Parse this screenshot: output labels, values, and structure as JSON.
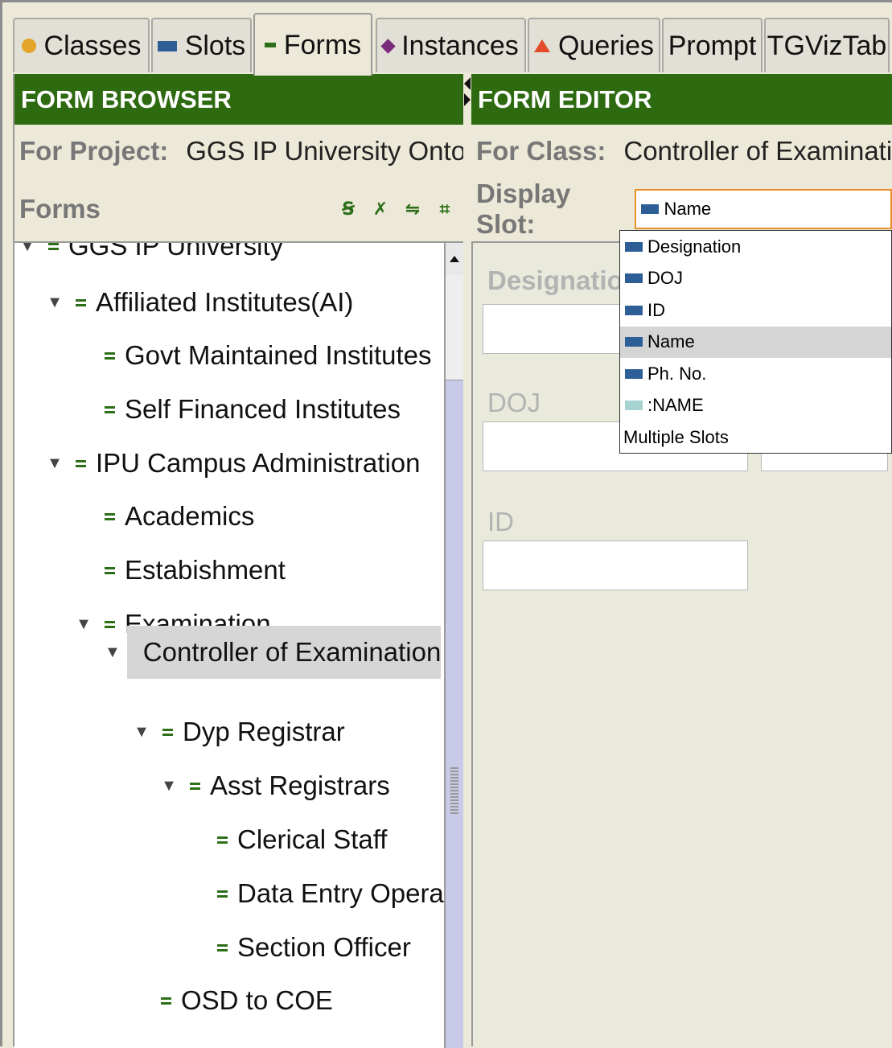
{
  "tabs": [
    {
      "label": "Classes",
      "icon": "class-dot-icon",
      "color": "#e5a52a"
    },
    {
      "label": "Slots",
      "icon": "slot-bar-icon",
      "color": "#2d5f96"
    },
    {
      "label": "Forms",
      "icon": "forms-icon",
      "color": "#2d6f18",
      "active": true
    },
    {
      "label": "Instances",
      "icon": "instance-diamond-icon",
      "color": "#7a2b7a"
    },
    {
      "label": "Queries",
      "icon": "query-triangle-icon",
      "color": "#e34a2a"
    },
    {
      "label": "Prompt"
    },
    {
      "label": "TGVizTab"
    }
  ],
  "form_browser": {
    "title": "FORM BROWSER",
    "project_label": "For Project:",
    "project_name": "GGS IP University Ontology",
    "forms_label": "Forms",
    "tree": [
      {
        "label": "GGS IP University",
        "expanded": true
      },
      {
        "label": "Affiliated Institutes(AI)",
        "expanded": true
      },
      {
        "label": "Govt Maintained Institutes"
      },
      {
        "label": "Self Financed Institutes"
      },
      {
        "label": "IPU Campus Administration",
        "expanded": true
      },
      {
        "label": "Academics"
      },
      {
        "label": "Estabishment"
      },
      {
        "label": "Examination",
        "expanded": true
      },
      {
        "label": "Controller of Examination",
        "expanded": true,
        "selected": true
      },
      {
        "label": "Dyp Registrar",
        "expanded": true
      },
      {
        "label": "Asst Registrars",
        "expanded": true
      },
      {
        "label": "Clerical Staff"
      },
      {
        "label": "Data Entry Operator"
      },
      {
        "label": "Section Officer"
      },
      {
        "label": "OSD to COE"
      }
    ]
  },
  "form_editor": {
    "title": "FORM EDITOR",
    "class_label": "For Class:",
    "class_name": "Controller of Examination",
    "display_slot_label": "Display Slot:",
    "display_slot_value": "Name",
    "fields": {
      "designation": "Designation",
      "doj": "DOJ",
      "id": "ID"
    },
    "dropdown_options": [
      {
        "label": "Designation",
        "icon": "slot"
      },
      {
        "label": "DOJ",
        "icon": "slot"
      },
      {
        "label": "ID",
        "icon": "slot"
      },
      {
        "label": "Name",
        "icon": "slot",
        "highlighted": true
      },
      {
        "label": "Ph. No.",
        "icon": "slot"
      },
      {
        "label": ":NAME",
        "icon": "system-slot"
      },
      {
        "label": "Multiple Slots"
      }
    ]
  }
}
